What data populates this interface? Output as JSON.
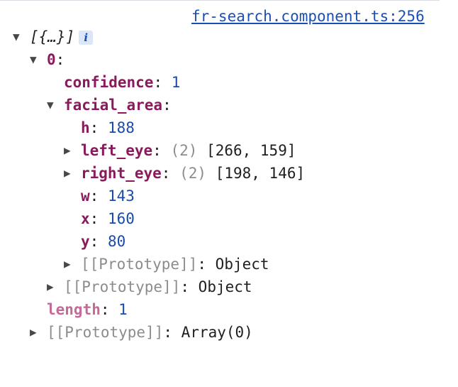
{
  "source_link": "fr-search.component.ts:256",
  "icons": {
    "expanded": "▼",
    "collapsed": "▶",
    "info": "i"
  },
  "tree": {
    "root_summary": "[{…}]",
    "item0": {
      "key": "0",
      "confidence": {
        "key": "confidence",
        "value": "1"
      },
      "facial_area": {
        "key": "facial_area",
        "h": {
          "key": "h",
          "value": "188"
        },
        "left_eye": {
          "key": "left_eye",
          "count": "(2)",
          "value": "[266, 159]"
        },
        "right_eye": {
          "key": "right_eye",
          "count": "(2)",
          "value": "[198, 146]"
        },
        "w": {
          "key": "w",
          "value": "143"
        },
        "x": {
          "key": "x",
          "value": "160"
        },
        "y": {
          "key": "y",
          "value": "80"
        },
        "prototype": {
          "key": "[[Prototype]]",
          "value": "Object"
        }
      },
      "prototype": {
        "key": "[[Prototype]]",
        "value": "Object"
      }
    },
    "length": {
      "key": "length",
      "value": "1"
    },
    "prototype": {
      "key": "[[Prototype]]",
      "value": "Array(0)"
    }
  },
  "colors": {
    "key": "#8a1a5c",
    "number": "#1a4ba8",
    "link": "#1a4fb5",
    "muted": "#8c8c8c"
  }
}
